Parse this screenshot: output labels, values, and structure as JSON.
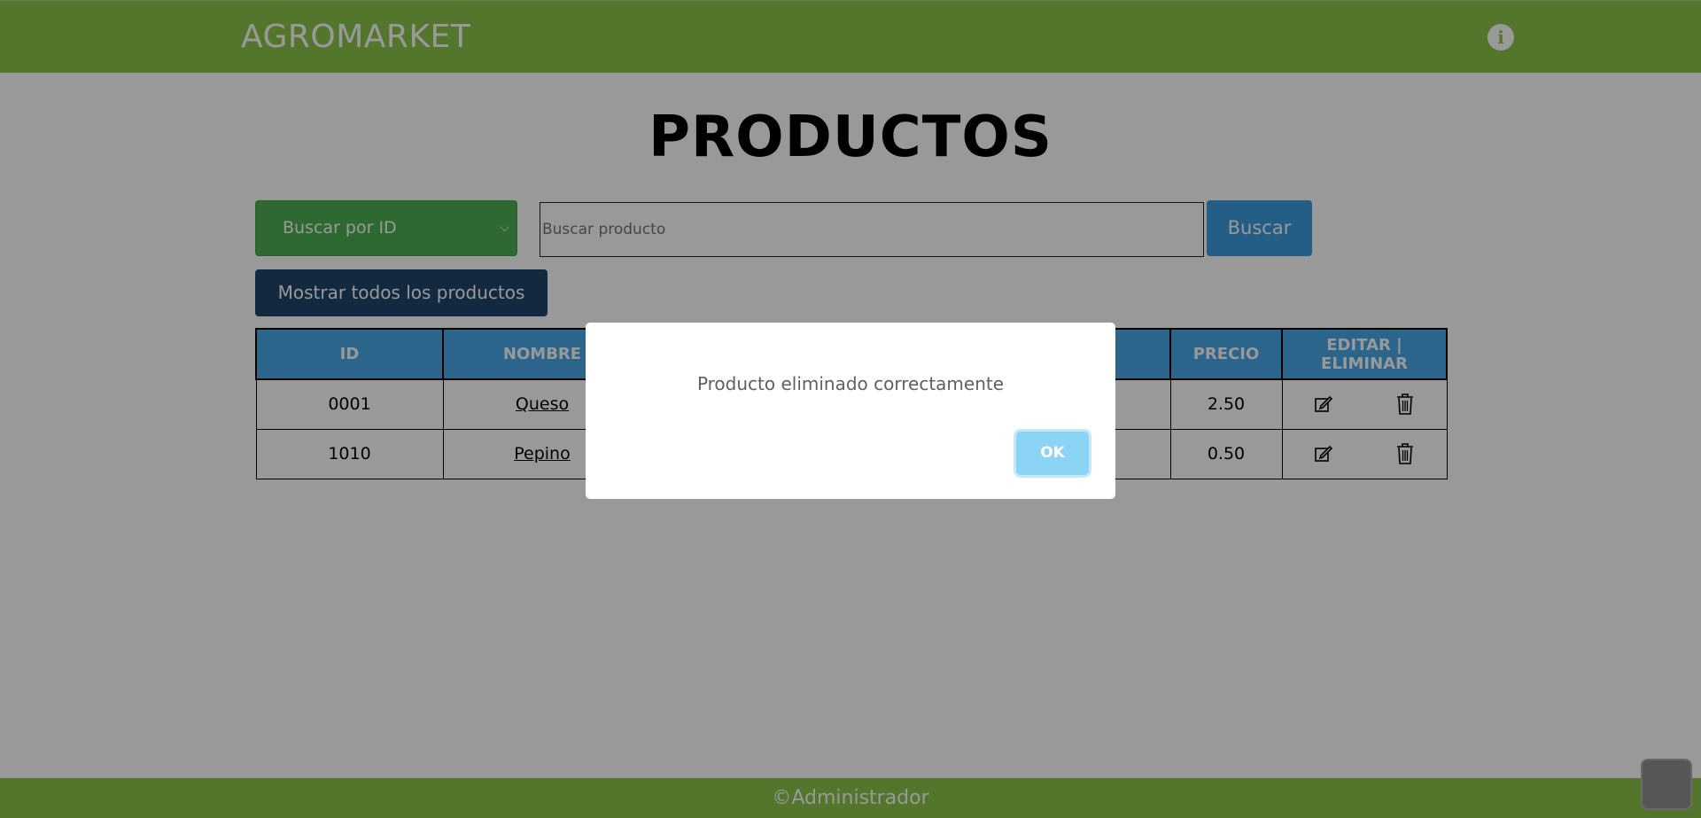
{
  "header": {
    "brand": "AGROMARKET"
  },
  "main": {
    "title": "PRODUCTOS",
    "search": {
      "select_value": "Buscar por ID",
      "placeholder": "Buscar producto",
      "button_label": "Buscar"
    },
    "show_all_label": "Mostrar todos los productos",
    "table": {
      "headers": {
        "id": "ID",
        "name": "NOMBRE",
        "price": "PRECIO",
        "actions": "EDITAR | ELIMINAR"
      },
      "rows": [
        {
          "id": "0001",
          "name": "Queso",
          "price": "2.50"
        },
        {
          "id": "1010",
          "name": "Pepino",
          "price": "0.50"
        }
      ]
    }
  },
  "dialog": {
    "message": "Producto eliminado correctamente",
    "ok_label": "OK"
  },
  "footer": {
    "text": "©Administrador"
  },
  "colors": {
    "header": "#8bc34a",
    "select": "#4caf50",
    "search_button": "#3d9be0",
    "show_all_button": "#21456b",
    "table_header": "#4aa9e8",
    "ok_button": "#8cd4f5"
  },
  "icons": [
    "info-icon",
    "chevron-down-icon",
    "edit-icon",
    "trash-icon"
  ]
}
